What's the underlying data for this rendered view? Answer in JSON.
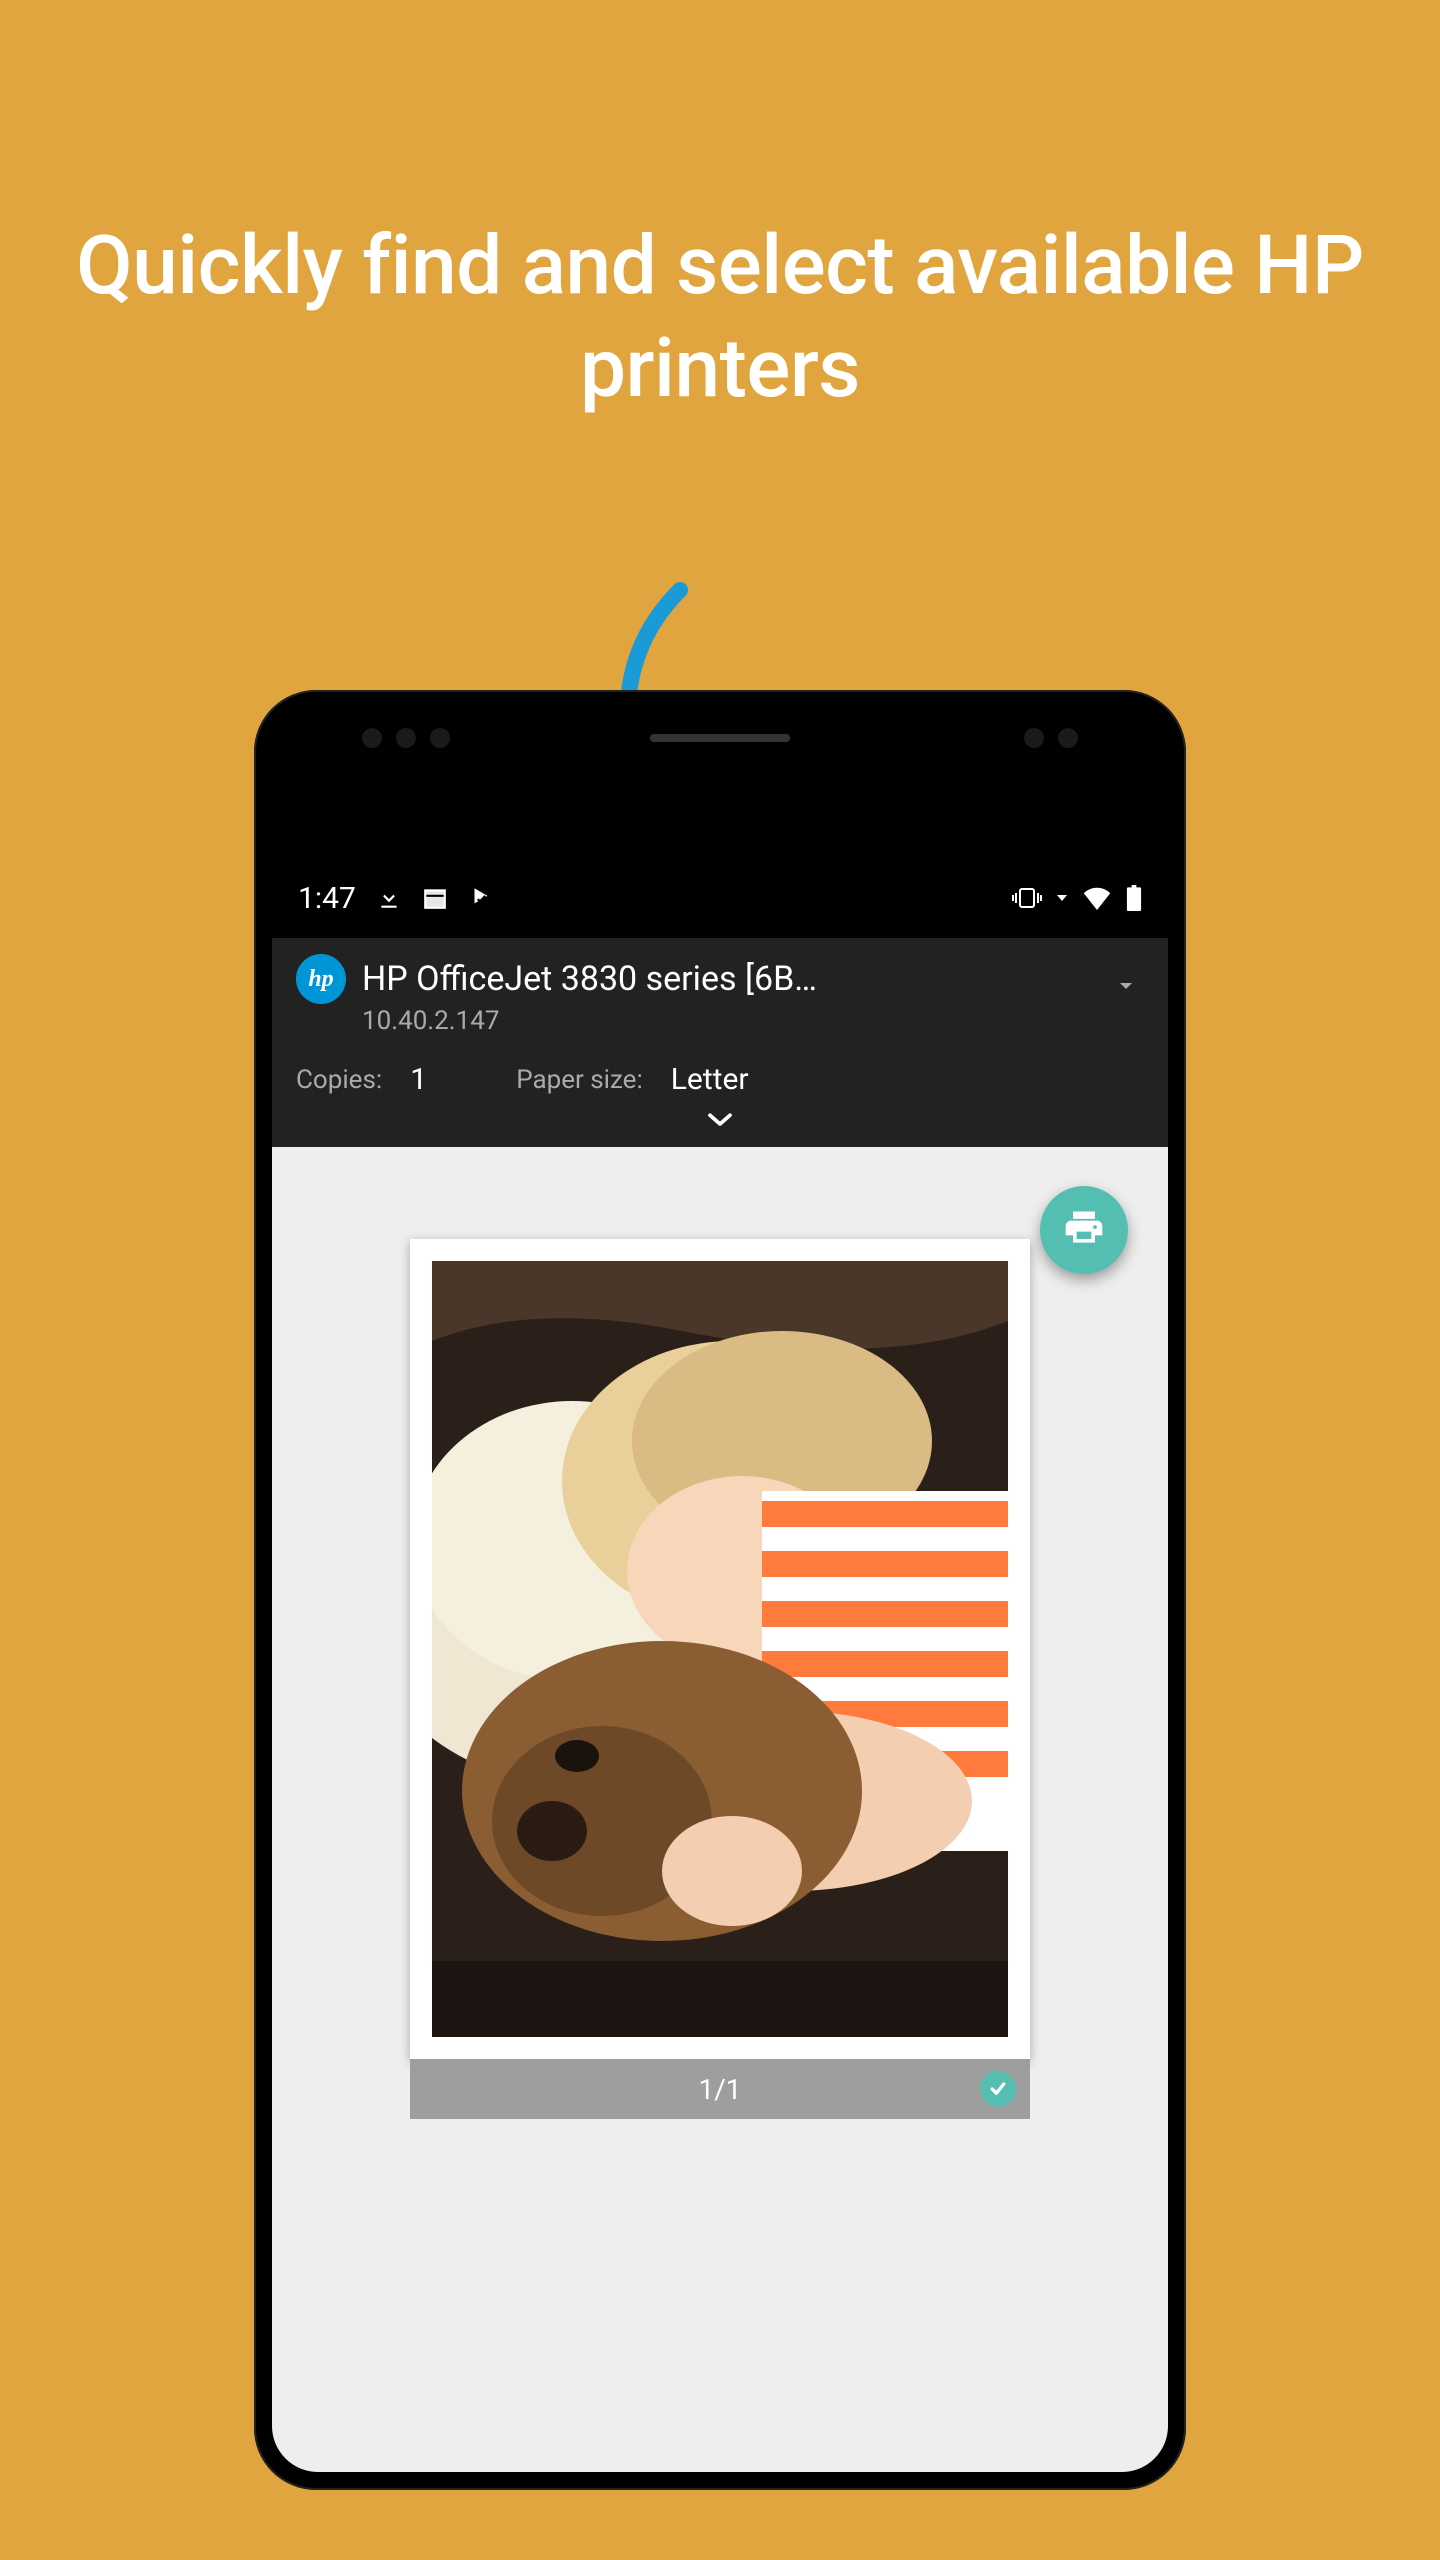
{
  "headline": "Quickly find and select available HP printers",
  "status": {
    "time": "1:47",
    "icons_left": [
      "download-icon",
      "calendar-icon",
      "playprotect-icon"
    ],
    "icons_right": [
      "vibrate-icon",
      "wifi-icon",
      "battery-icon"
    ]
  },
  "printer": {
    "logo_text": "hp",
    "name": "HP OfficeJet 3830 series [6B…",
    "ip": "10.40.2.147"
  },
  "settings": {
    "copies_label": "Copies:",
    "copies_value": "1",
    "paper_label": "Paper size:",
    "paper_value": "Letter"
  },
  "page_counter": "1/1",
  "colors": {
    "background": "#e0a53e",
    "accent": "#54beb0",
    "arrow": "#1a9ad6",
    "hp_blue": "#0096d6"
  }
}
